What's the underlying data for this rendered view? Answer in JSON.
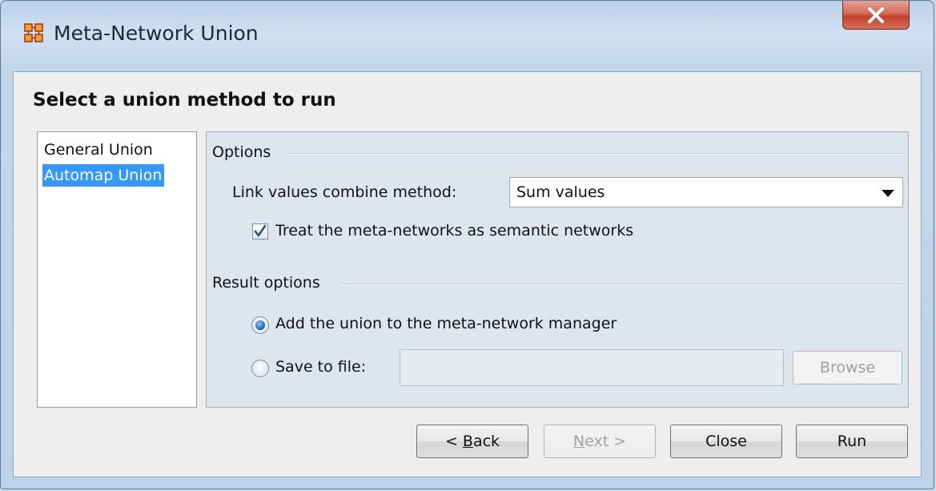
{
  "window": {
    "title": "Meta-Network Union",
    "icon": "meta-network-icon",
    "close_icon": "close-icon"
  },
  "heading": "Select a union method to run",
  "methods": [
    {
      "label": "General Union",
      "selected": false
    },
    {
      "label": "Automap Union",
      "selected": true
    }
  ],
  "options": {
    "group_title": "Options",
    "combine_label": "Link values combine method:",
    "combine_value": "Sum values",
    "semantic_checkbox": {
      "label": "Treat the meta-networks as semantic networks",
      "checked": true
    }
  },
  "result": {
    "group_title": "Result options",
    "add_union": {
      "label": "Add the union to the meta-network manager",
      "selected": true
    },
    "save_file": {
      "label": "Save to file:",
      "selected": false,
      "value": ""
    },
    "browse_label": "Browse"
  },
  "buttons": {
    "back": {
      "prefix": "< ",
      "mnemonic": "B",
      "rest": "ack",
      "enabled": true
    },
    "next": {
      "mnemonic": "N",
      "rest": "ext >",
      "enabled": false
    },
    "close": "Close",
    "run": "Run"
  },
  "colors": {
    "selection": "#3399ff",
    "close_button": "#c94a36"
  }
}
